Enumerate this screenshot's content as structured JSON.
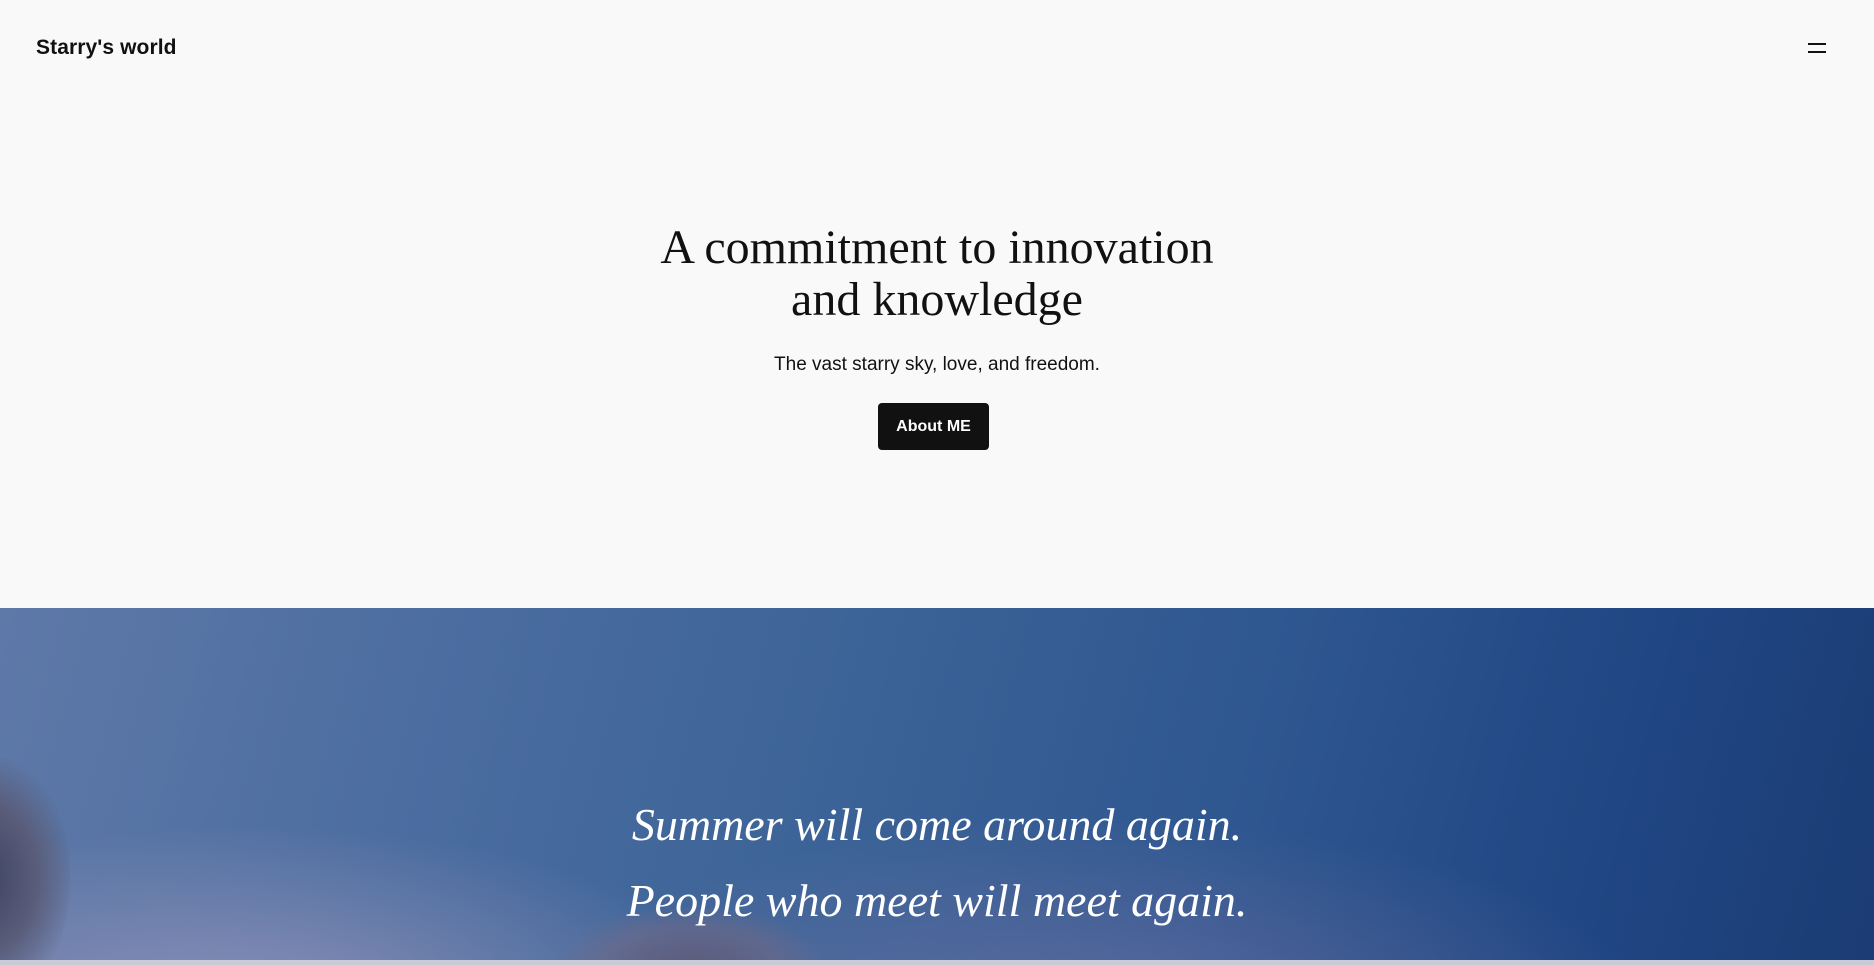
{
  "header": {
    "site_title": "Starry's world",
    "menu_icon": "hamburger-menu-icon"
  },
  "hero": {
    "title_line1": "A commitment to innovation",
    "title_line2": "and knowledge",
    "subtitle": "The vast starry sky, love, and freedom.",
    "button_label": "About ME"
  },
  "banner": {
    "quote_line1": "Summer will come around again.",
    "quote_line2": "People who meet will meet again."
  },
  "colors": {
    "background": "#f9f9f9",
    "text": "#111111",
    "button_bg": "#111111",
    "button_text": "#ffffff",
    "sky_light": "#5e79a8",
    "sky_dark": "#1b3c74"
  }
}
